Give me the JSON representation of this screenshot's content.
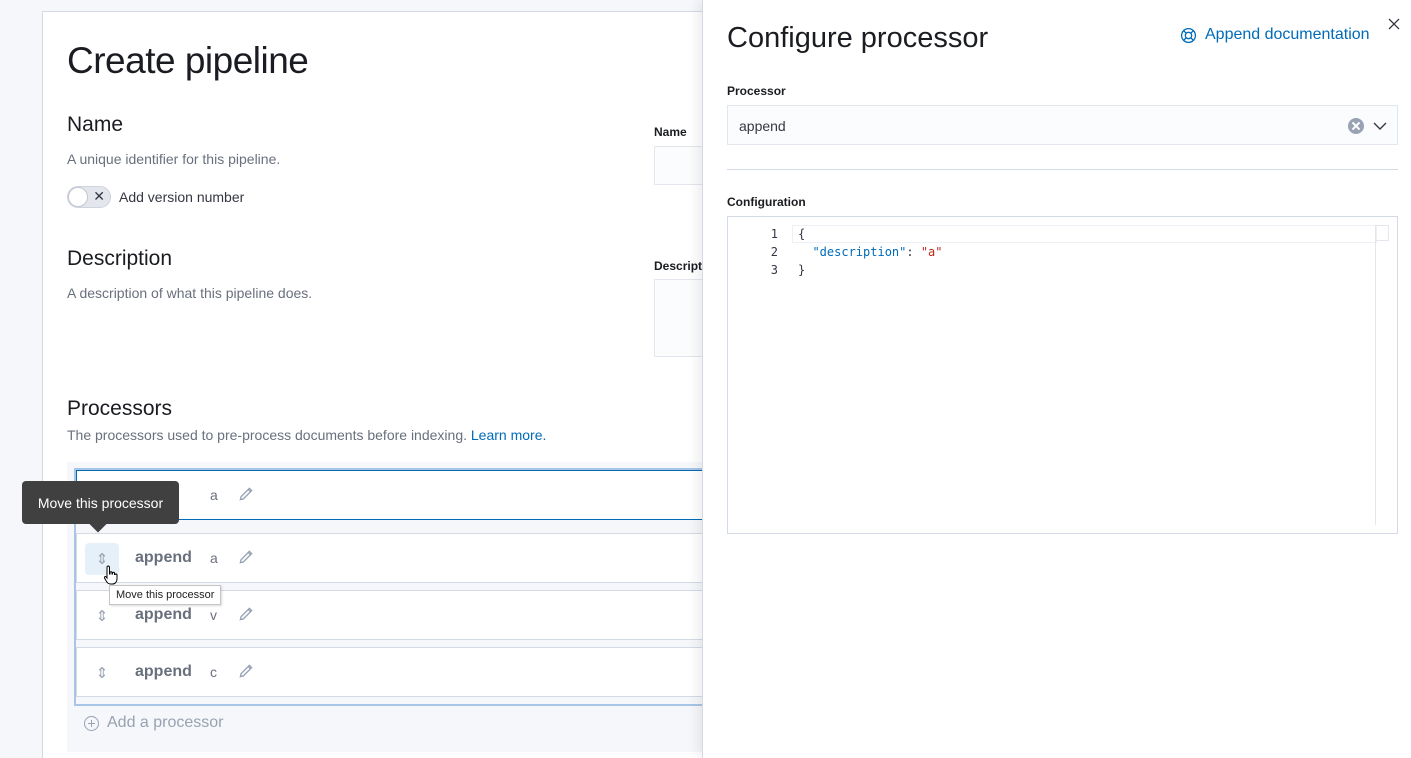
{
  "page": {
    "title": "Create pipeline",
    "name_section": {
      "title": "Name",
      "description": "A unique identifier for this pipeline.",
      "field_label": "Name",
      "version_toggle_label": "Add version number"
    },
    "description_section": {
      "title": "Description",
      "description": "A description of what this pipeline does.",
      "field_label": "Descript"
    },
    "processors_section": {
      "title": "Processors",
      "description": "The processors used to pre-process documents before indexing.",
      "learn_more": "Learn more.",
      "items": [
        {
          "type": "append",
          "desc": "a"
        },
        {
          "type": "append",
          "desc": "a"
        },
        {
          "type": "append",
          "desc": "v"
        },
        {
          "type": "append",
          "desc": "c"
        }
      ],
      "first_item_visible_text": "nd",
      "add_label": "Add a processor"
    },
    "tooltip_dark": "Move this processor",
    "tooltip_native": "Move this processor"
  },
  "flyout": {
    "title": "Configure processor",
    "doc_link": "Append documentation",
    "processor_label": "Processor",
    "processor_value": "append",
    "config_label": "Configuration",
    "editor": {
      "line_numbers": [
        "1",
        "2",
        "3"
      ],
      "line1": "{",
      "line2_key": "\"description\"",
      "line2_colon": ": ",
      "line2_value": "\"a\"",
      "line3": "}"
    }
  },
  "colors": {
    "accent": "#006bb8",
    "string": "#bd271e",
    "tooltip_bg": "#404040"
  }
}
